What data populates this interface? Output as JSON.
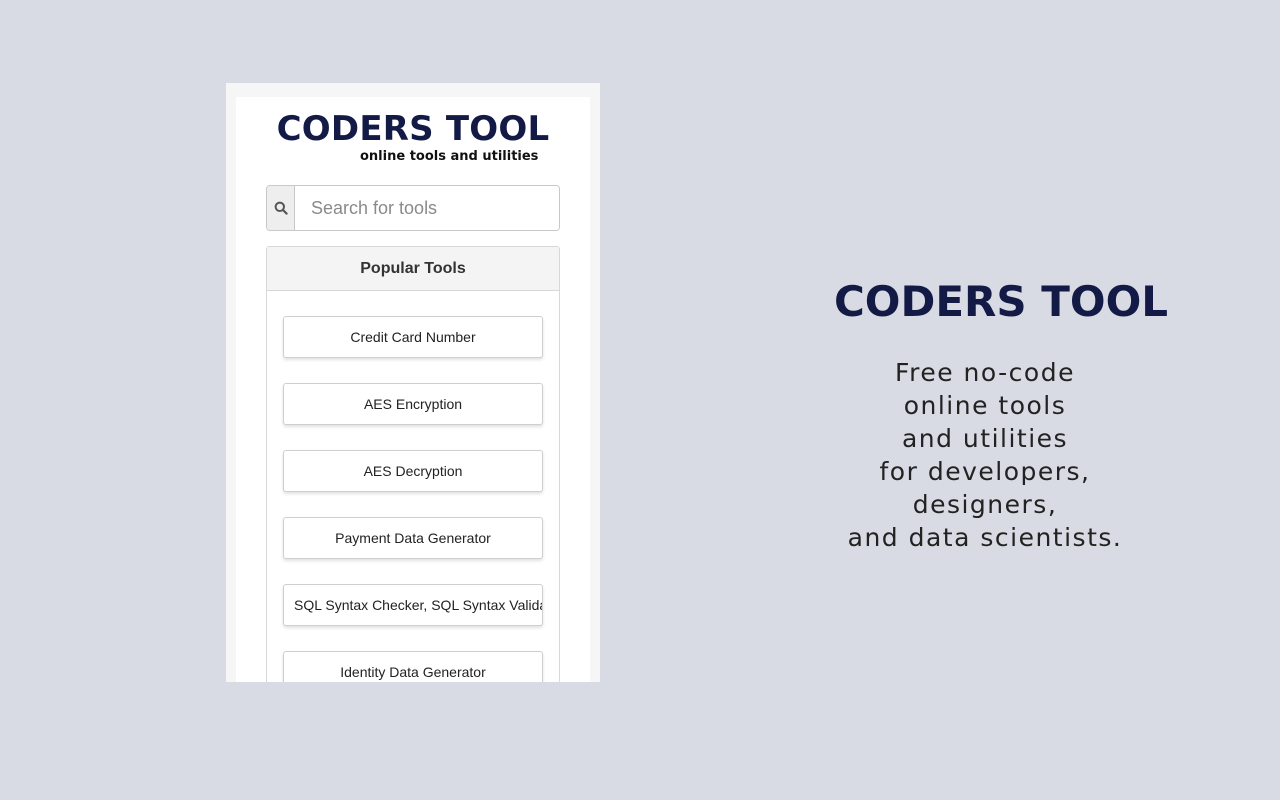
{
  "popup": {
    "brand_title": "CODERS TOOL",
    "brand_subtitle": "online tools and utilities",
    "search": {
      "icon": "search-icon",
      "placeholder": "Search for tools",
      "value": ""
    },
    "panel_title": "Popular Tools",
    "tools": [
      "Credit Card Number",
      "AES Encryption",
      "AES Decryption",
      "Payment Data Generator",
      "SQL Syntax Checker, SQL Syntax Validator",
      "Identity Data Generator"
    ]
  },
  "promo": {
    "title": "CODERS TOOL",
    "lines": [
      "Free no-code",
      "online tools",
      "and utilities",
      "for developers,",
      "designers,",
      "and data scientists."
    ]
  },
  "colors": {
    "background": "#d8dbe3",
    "brand": "#121a45"
  }
}
